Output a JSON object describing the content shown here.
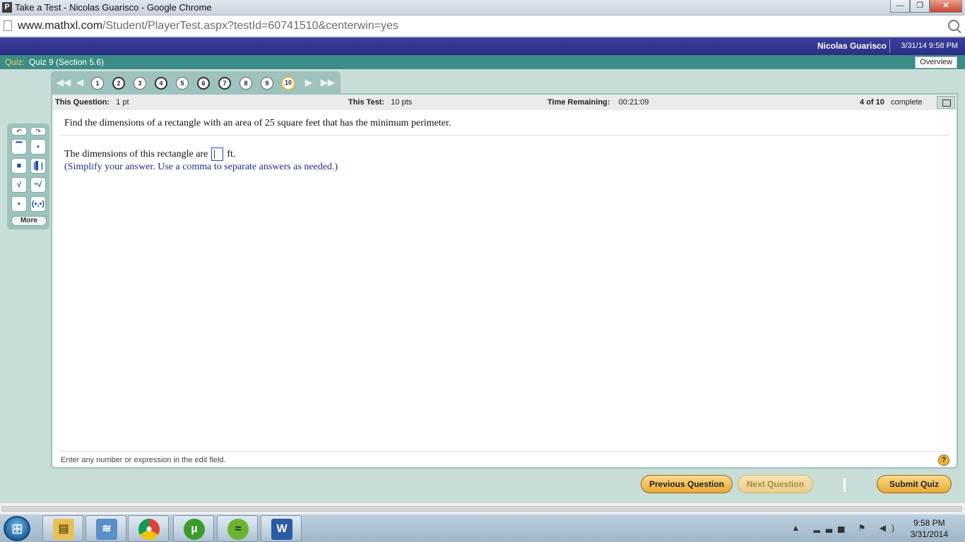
{
  "window": {
    "app_icon": "P",
    "title": "Take a Test - Nicolas Guarisco - Google Chrome",
    "minimize": "—",
    "maximize": "❐",
    "close": "✕"
  },
  "address": {
    "host": "www.mathxl.com",
    "path": "/Student/PlayerTest.aspx?testId=60741510&centerwin=yes"
  },
  "header": {
    "username": "Nicolas Guarisco",
    "datetime": "3/31/14 9:58 PM"
  },
  "quiz": {
    "label": "Quiz:",
    "name": "Quiz 9 (Section 5.6)",
    "overview_label": "Overview"
  },
  "navigator": {
    "questions": [
      "1",
      "2",
      "3",
      "4",
      "5",
      "6",
      "7",
      "8",
      "9",
      "10"
    ],
    "current": "10"
  },
  "palette": {
    "more_label": "More"
  },
  "info": {
    "this_question_label": "This Question:",
    "this_question_value": "1 pt",
    "this_test_label": "This Test:",
    "this_test_value": "10 pts",
    "time_remaining_label": "Time Remaining:",
    "time_remaining_value": "00:21:09",
    "progress_count": "4 of 10",
    "progress_label": "complete"
  },
  "question": {
    "text": "Find the dimensions of a rectangle with an area of 25 square feet that has the minimum perimeter.",
    "answer_prefix": "The dimensions of this rectangle are",
    "answer_value": "",
    "answer_suffix": "ft.",
    "instruction": "(Simplify your answer. Use a comma to separate answers as needed.)"
  },
  "hint": {
    "text": "Enter any number or expression in the edit field.",
    "help": "?"
  },
  "buttons": {
    "previous": "Previous Question",
    "next": "Next Question",
    "submit": "Submit Quiz"
  },
  "taskbar": {
    "clock_time": "9:58 PM",
    "clock_date": "3/31/2014"
  },
  "colors": {
    "header_blue": "#2b2f86",
    "quiz_teal": "#3b8b86",
    "button_gold": "#e8a935",
    "answer_blue": "#1c4fd0"
  }
}
